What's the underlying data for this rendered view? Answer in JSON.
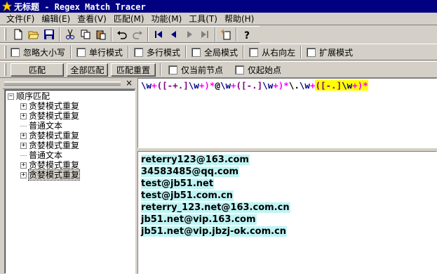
{
  "window": {
    "title": "无标题 - Regex Match Tracer"
  },
  "menu": [
    "文件(F)",
    "编辑(E)",
    "查看(V)",
    "匹配(M)",
    "功能(M)",
    "工具(T)",
    "帮助(H)"
  ],
  "toolbar": {
    "icons": [
      "new-file-icon",
      "open-folder-icon",
      "save-icon",
      "cut-icon",
      "copy-icon",
      "paste-icon",
      "undo-icon",
      "redo-icon",
      "first-icon",
      "prev-icon",
      "next-icon",
      "last-icon",
      "new-item-icon",
      "help-icon"
    ]
  },
  "options": {
    "ignore_case": "忽略大小写",
    "single_line": "单行模式",
    "multi_line": "多行模式",
    "global": "全局模式",
    "right_to_left": "从右向左",
    "extended": "扩展模式"
  },
  "buttons": {
    "match": "匹配",
    "match_all": "全部匹配",
    "match_reset": "匹配重置",
    "current_node_only": "仅当前节点",
    "start_anchor_only": "仅起始点"
  },
  "tree": {
    "root": "顺序匹配",
    "nodes": [
      {
        "label": "贪婪模式重复",
        "expandable": true
      },
      {
        "label": "贪婪模式重复",
        "expandable": true
      },
      {
        "label": "普通文本",
        "expandable": false
      },
      {
        "label": "贪婪模式重复",
        "expandable": true
      },
      {
        "label": "贪婪模式重复",
        "expandable": true
      },
      {
        "label": "普通文本",
        "expandable": false
      },
      {
        "label": "贪婪模式重复",
        "expandable": true
      },
      {
        "label": "贪婪模式重复",
        "expandable": true,
        "selected": true
      }
    ]
  },
  "regex": {
    "tokens": [
      {
        "text": "\\w",
        "color": "#000080"
      },
      {
        "text": "+",
        "color": "#ff00ff"
      },
      {
        "text": "([-+.]",
        "color": "#800080"
      },
      {
        "text": "\\w",
        "color": "#000080"
      },
      {
        "text": "+)",
        "color": "#ff00ff"
      },
      {
        "text": "*",
        "color": "#ff00ff"
      },
      {
        "text": "@",
        "color": "#000000"
      },
      {
        "text": "\\w",
        "color": "#000080"
      },
      {
        "text": "+",
        "color": "#ff00ff"
      },
      {
        "text": "([-.]",
        "color": "#800080"
      },
      {
        "text": "\\w",
        "color": "#000080"
      },
      {
        "text": "+)",
        "color": "#ff00ff"
      },
      {
        "text": "*",
        "color": "#ff00ff"
      },
      {
        "text": "\\.",
        "color": "#000000"
      },
      {
        "text": "\\w",
        "color": "#000080"
      },
      {
        "text": "+",
        "color": "#ff00ff"
      },
      {
        "text": "([-.]",
        "color": "#800080",
        "highlight": "#ffff00"
      },
      {
        "text": "\\w",
        "color": "#000080",
        "highlight": "#ffff00"
      },
      {
        "text": "+)",
        "color": "#ff00ff",
        "highlight": "#ffff00"
      },
      {
        "text": "*",
        "color": "#ff00ff",
        "highlight": "#ffff00"
      }
    ]
  },
  "matches": [
    "reterry123@163.com",
    "34583485@qq.com",
    "test@jb51.net",
    "test@jb51.com.cn",
    "reterry_123.net@163.com.cn",
    "jb51.net@vip.163.com",
    "jb51.net@vip.jbzj-ok.com.cn"
  ]
}
